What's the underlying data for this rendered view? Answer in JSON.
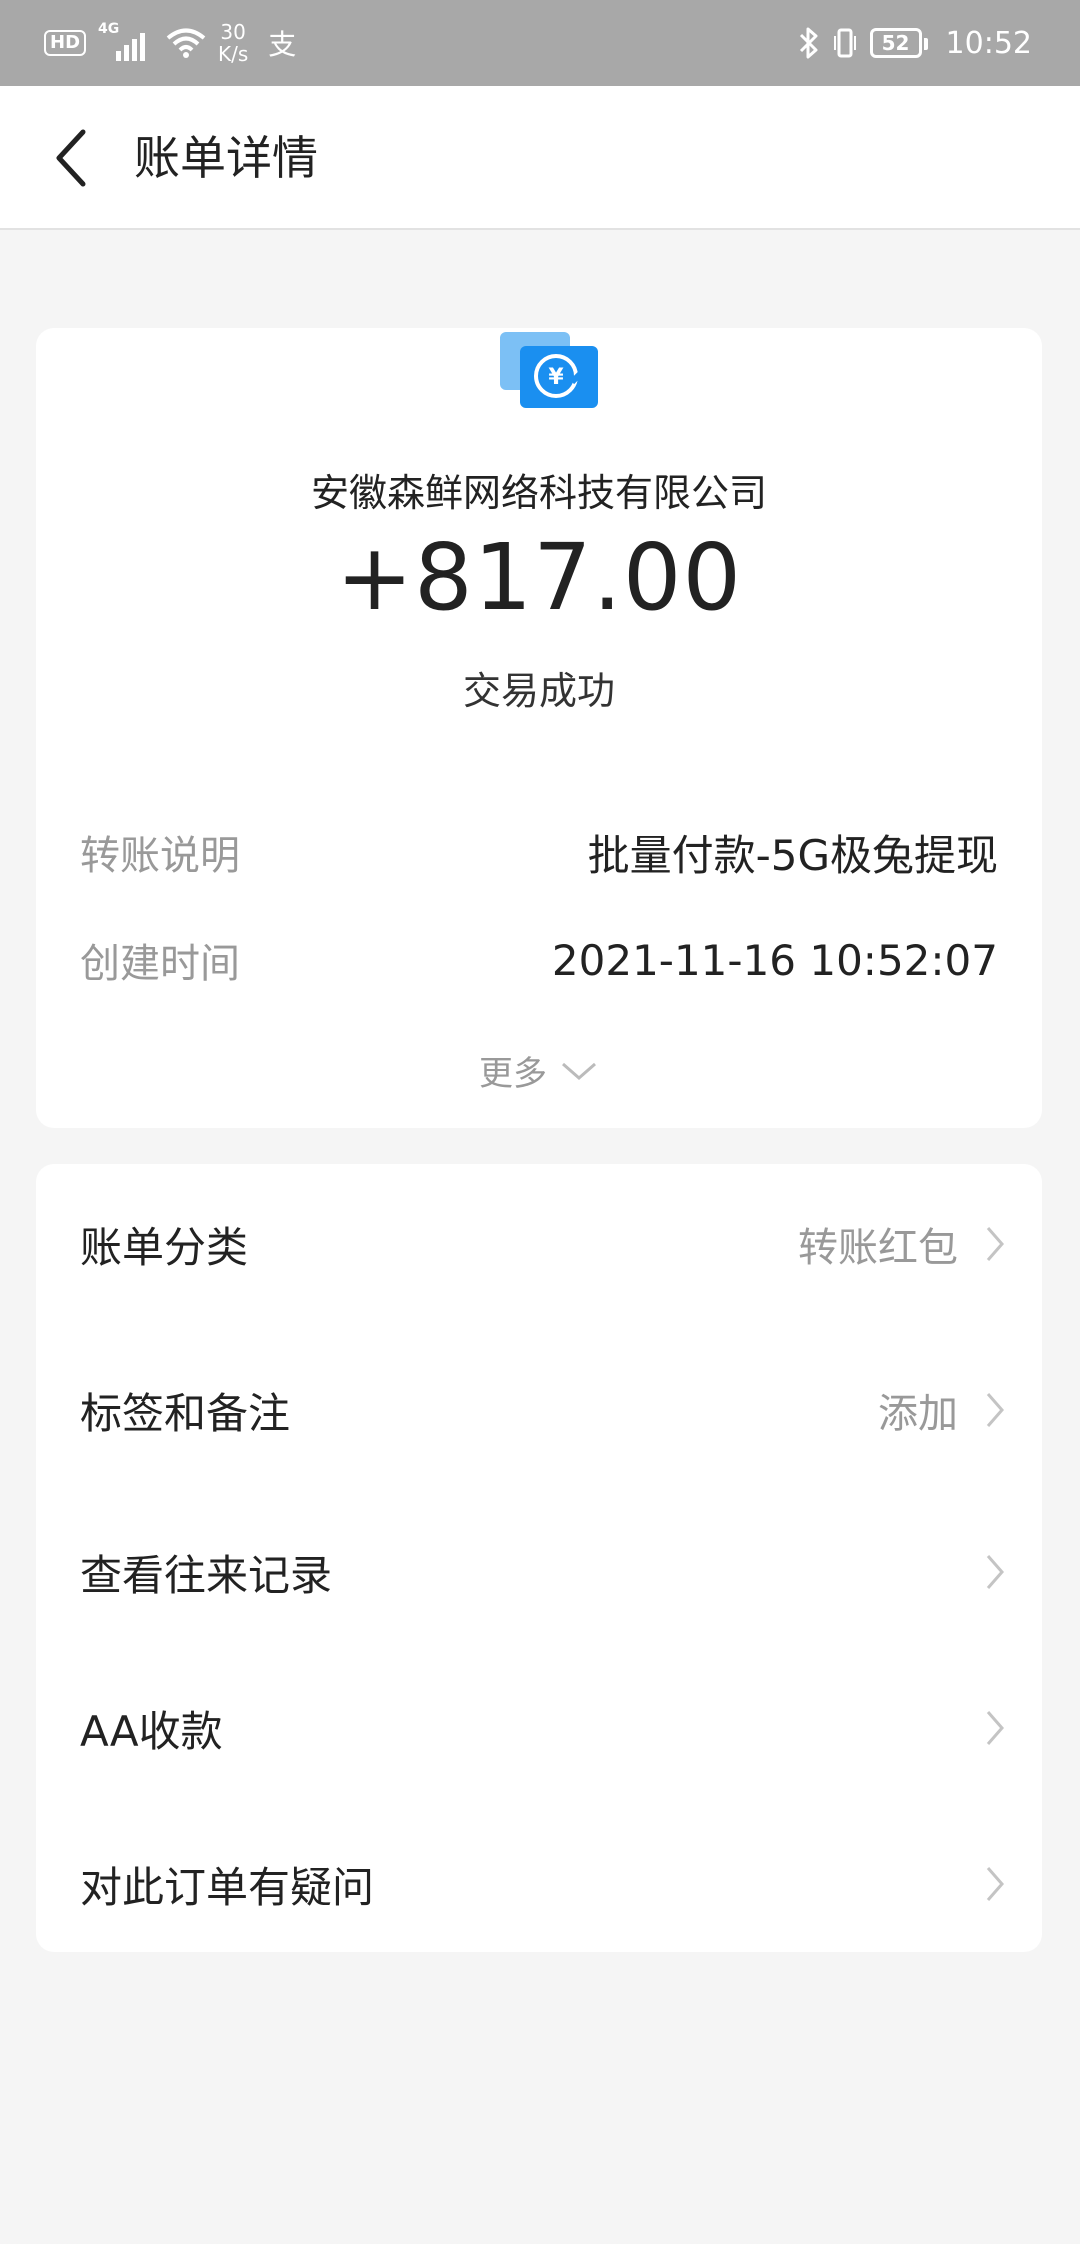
{
  "status_bar": {
    "hd": "HD",
    "network": "4G",
    "speed_value": "30",
    "speed_unit": "K/s",
    "app_glyph": "支",
    "battery": "52",
    "time": "10:52"
  },
  "header": {
    "title": "账单详情"
  },
  "bill": {
    "payee": "安徽森鲜网络科技有限公司",
    "amount": "+817.00",
    "status": "交易成功",
    "rows": [
      {
        "label": "转账说明",
        "value": "批量付款-5G极兔提现"
      },
      {
        "label": "创建时间",
        "value": "2021-11-16 10:52:07"
      }
    ],
    "more_label": "更多"
  },
  "actions": [
    {
      "label": "账单分类",
      "value": "转账红包"
    },
    {
      "label": "标签和备注",
      "value": "添加"
    },
    {
      "label": "查看往来记录",
      "value": ""
    },
    {
      "label": "AA收款",
      "value": ""
    },
    {
      "label": "对此订单有疑问",
      "value": ""
    }
  ],
  "colors": {
    "status_bar_bg": "#a8a8a8",
    "page_bg": "#f5f5f5",
    "card_bg": "#ffffff",
    "icon_blue": "#1a8ff0"
  }
}
